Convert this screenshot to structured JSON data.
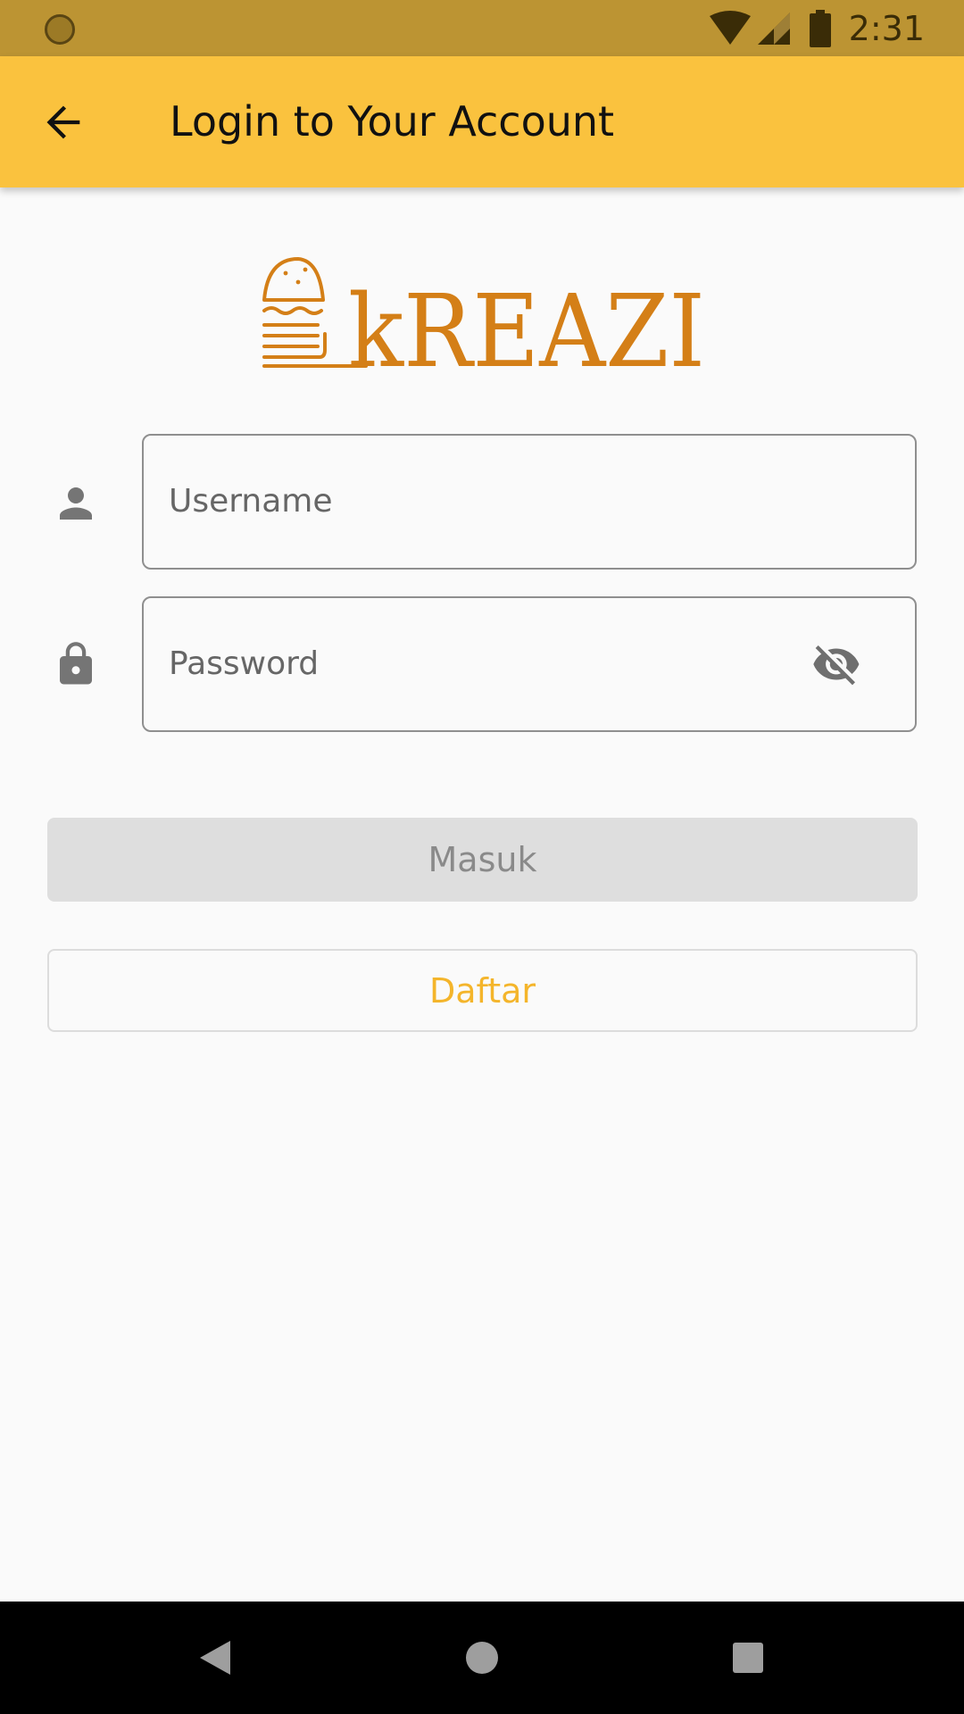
{
  "status_bar": {
    "time": "2:31",
    "icons": [
      "notification-dot-icon",
      "wifi-icon",
      "cell-signal-icon",
      "battery-icon"
    ]
  },
  "app_bar": {
    "title": "Login to Your Account",
    "back_icon": "arrow-back-icon"
  },
  "logo": {
    "text": "kREAZI",
    "color": "#d47f17"
  },
  "form": {
    "username": {
      "placeholder": "Username",
      "value": "",
      "icon": "person-icon"
    },
    "password": {
      "placeholder": "Password",
      "value": "",
      "icon": "lock-icon",
      "toggle_icon": "visibility-off-icon"
    }
  },
  "buttons": {
    "login_label": "Masuk",
    "register_label": "Daftar"
  },
  "nav_bar": {
    "icons": [
      "back-triangle-icon",
      "home-circle-icon",
      "recents-square-icon"
    ]
  },
  "colors": {
    "status_bar": "#bc9433",
    "app_bar": "#fac23e",
    "accent": "#f4b52b",
    "background": "#fafafa"
  }
}
